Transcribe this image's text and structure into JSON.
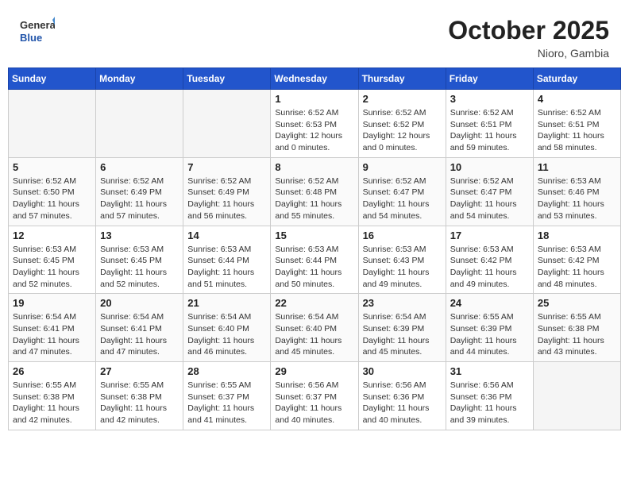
{
  "header": {
    "logo_general": "General",
    "logo_blue": "Blue",
    "month_title": "October 2025",
    "location": "Nioro, Gambia"
  },
  "weekdays": [
    "Sunday",
    "Monday",
    "Tuesday",
    "Wednesday",
    "Thursday",
    "Friday",
    "Saturday"
  ],
  "weeks": [
    [
      {
        "day": "",
        "info": ""
      },
      {
        "day": "",
        "info": ""
      },
      {
        "day": "",
        "info": ""
      },
      {
        "day": "1",
        "info": "Sunrise: 6:52 AM\nSunset: 6:53 PM\nDaylight: 12 hours\nand 0 minutes."
      },
      {
        "day": "2",
        "info": "Sunrise: 6:52 AM\nSunset: 6:52 PM\nDaylight: 12 hours\nand 0 minutes."
      },
      {
        "day": "3",
        "info": "Sunrise: 6:52 AM\nSunset: 6:51 PM\nDaylight: 11 hours\nand 59 minutes."
      },
      {
        "day": "4",
        "info": "Sunrise: 6:52 AM\nSunset: 6:51 PM\nDaylight: 11 hours\nand 58 minutes."
      }
    ],
    [
      {
        "day": "5",
        "info": "Sunrise: 6:52 AM\nSunset: 6:50 PM\nDaylight: 11 hours\nand 57 minutes."
      },
      {
        "day": "6",
        "info": "Sunrise: 6:52 AM\nSunset: 6:49 PM\nDaylight: 11 hours\nand 57 minutes."
      },
      {
        "day": "7",
        "info": "Sunrise: 6:52 AM\nSunset: 6:49 PM\nDaylight: 11 hours\nand 56 minutes."
      },
      {
        "day": "8",
        "info": "Sunrise: 6:52 AM\nSunset: 6:48 PM\nDaylight: 11 hours\nand 55 minutes."
      },
      {
        "day": "9",
        "info": "Sunrise: 6:52 AM\nSunset: 6:47 PM\nDaylight: 11 hours\nand 54 minutes."
      },
      {
        "day": "10",
        "info": "Sunrise: 6:52 AM\nSunset: 6:47 PM\nDaylight: 11 hours\nand 54 minutes."
      },
      {
        "day": "11",
        "info": "Sunrise: 6:53 AM\nSunset: 6:46 PM\nDaylight: 11 hours\nand 53 minutes."
      }
    ],
    [
      {
        "day": "12",
        "info": "Sunrise: 6:53 AM\nSunset: 6:45 PM\nDaylight: 11 hours\nand 52 minutes."
      },
      {
        "day": "13",
        "info": "Sunrise: 6:53 AM\nSunset: 6:45 PM\nDaylight: 11 hours\nand 52 minutes."
      },
      {
        "day": "14",
        "info": "Sunrise: 6:53 AM\nSunset: 6:44 PM\nDaylight: 11 hours\nand 51 minutes."
      },
      {
        "day": "15",
        "info": "Sunrise: 6:53 AM\nSunset: 6:44 PM\nDaylight: 11 hours\nand 50 minutes."
      },
      {
        "day": "16",
        "info": "Sunrise: 6:53 AM\nSunset: 6:43 PM\nDaylight: 11 hours\nand 49 minutes."
      },
      {
        "day": "17",
        "info": "Sunrise: 6:53 AM\nSunset: 6:42 PM\nDaylight: 11 hours\nand 49 minutes."
      },
      {
        "day": "18",
        "info": "Sunrise: 6:53 AM\nSunset: 6:42 PM\nDaylight: 11 hours\nand 48 minutes."
      }
    ],
    [
      {
        "day": "19",
        "info": "Sunrise: 6:54 AM\nSunset: 6:41 PM\nDaylight: 11 hours\nand 47 minutes."
      },
      {
        "day": "20",
        "info": "Sunrise: 6:54 AM\nSunset: 6:41 PM\nDaylight: 11 hours\nand 47 minutes."
      },
      {
        "day": "21",
        "info": "Sunrise: 6:54 AM\nSunset: 6:40 PM\nDaylight: 11 hours\nand 46 minutes."
      },
      {
        "day": "22",
        "info": "Sunrise: 6:54 AM\nSunset: 6:40 PM\nDaylight: 11 hours\nand 45 minutes."
      },
      {
        "day": "23",
        "info": "Sunrise: 6:54 AM\nSunset: 6:39 PM\nDaylight: 11 hours\nand 45 minutes."
      },
      {
        "day": "24",
        "info": "Sunrise: 6:55 AM\nSunset: 6:39 PM\nDaylight: 11 hours\nand 44 minutes."
      },
      {
        "day": "25",
        "info": "Sunrise: 6:55 AM\nSunset: 6:38 PM\nDaylight: 11 hours\nand 43 minutes."
      }
    ],
    [
      {
        "day": "26",
        "info": "Sunrise: 6:55 AM\nSunset: 6:38 PM\nDaylight: 11 hours\nand 42 minutes."
      },
      {
        "day": "27",
        "info": "Sunrise: 6:55 AM\nSunset: 6:38 PM\nDaylight: 11 hours\nand 42 minutes."
      },
      {
        "day": "28",
        "info": "Sunrise: 6:55 AM\nSunset: 6:37 PM\nDaylight: 11 hours\nand 41 minutes."
      },
      {
        "day": "29",
        "info": "Sunrise: 6:56 AM\nSunset: 6:37 PM\nDaylight: 11 hours\nand 40 minutes."
      },
      {
        "day": "30",
        "info": "Sunrise: 6:56 AM\nSunset: 6:36 PM\nDaylight: 11 hours\nand 40 minutes."
      },
      {
        "day": "31",
        "info": "Sunrise: 6:56 AM\nSunset: 6:36 PM\nDaylight: 11 hours\nand 39 minutes."
      },
      {
        "day": "",
        "info": ""
      }
    ]
  ]
}
